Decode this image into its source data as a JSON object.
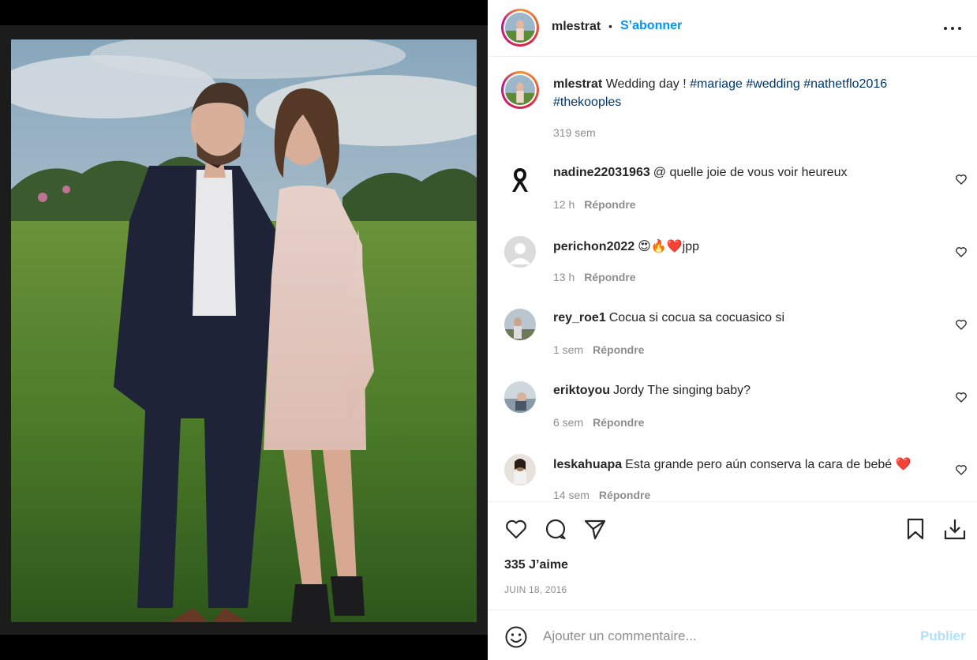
{
  "post": {
    "username": "mlestrat",
    "separator": "•",
    "follow_label": "S’abonner",
    "more_icon": "more-horizontal-icon",
    "caption": {
      "username": "mlestrat",
      "text": "Wedding day !",
      "hashtags": [
        "#mariage",
        "#wedding",
        "#nathetflo2016",
        "#thekooples"
      ],
      "time": "319 sem"
    },
    "comments": [
      {
        "user": "nadine22031963",
        "text": "@ quelle joie de vous voir heureux",
        "time": "12 h",
        "reply": "Répondre",
        "avatar": "black-ribbon"
      },
      {
        "user": "perichon2022",
        "text": "😍🔥❤️jpp",
        "time": "13 h",
        "reply": "Répondre",
        "avatar": "default"
      },
      {
        "user": "rey_roe1",
        "text": "Cocua si cocua sa cocuasico si",
        "time": "1 sem",
        "reply": "Répondre",
        "avatar": "photo"
      },
      {
        "user": "eriktoyou",
        "text": "Jordy The singing baby?",
        "time": "6 sem",
        "reply": "Répondre",
        "avatar": "photo"
      },
      {
        "user": "leskahuapa",
        "text": "Esta grande pero aún conserva la cara de bebé ❤️",
        "time": "14 sem",
        "reply": "Répondre",
        "avatar": "photo"
      }
    ],
    "actions": {
      "like_icon": "heart-icon",
      "comment_icon": "comment-icon",
      "share_icon": "send-icon",
      "save_icon": "bookmark-icon",
      "download_icon": "download-icon"
    },
    "likes": "335 J’aime",
    "date": "JUIN 18, 2016",
    "add_comment": {
      "placeholder": "Ajouter un commentaire...",
      "post_label": "Publier"
    }
  },
  "colors": {
    "accent": "#0095f6",
    "hashtag": "#00376b",
    "muted": "#8e8e8e",
    "post_disabled": "#b2dffc"
  }
}
